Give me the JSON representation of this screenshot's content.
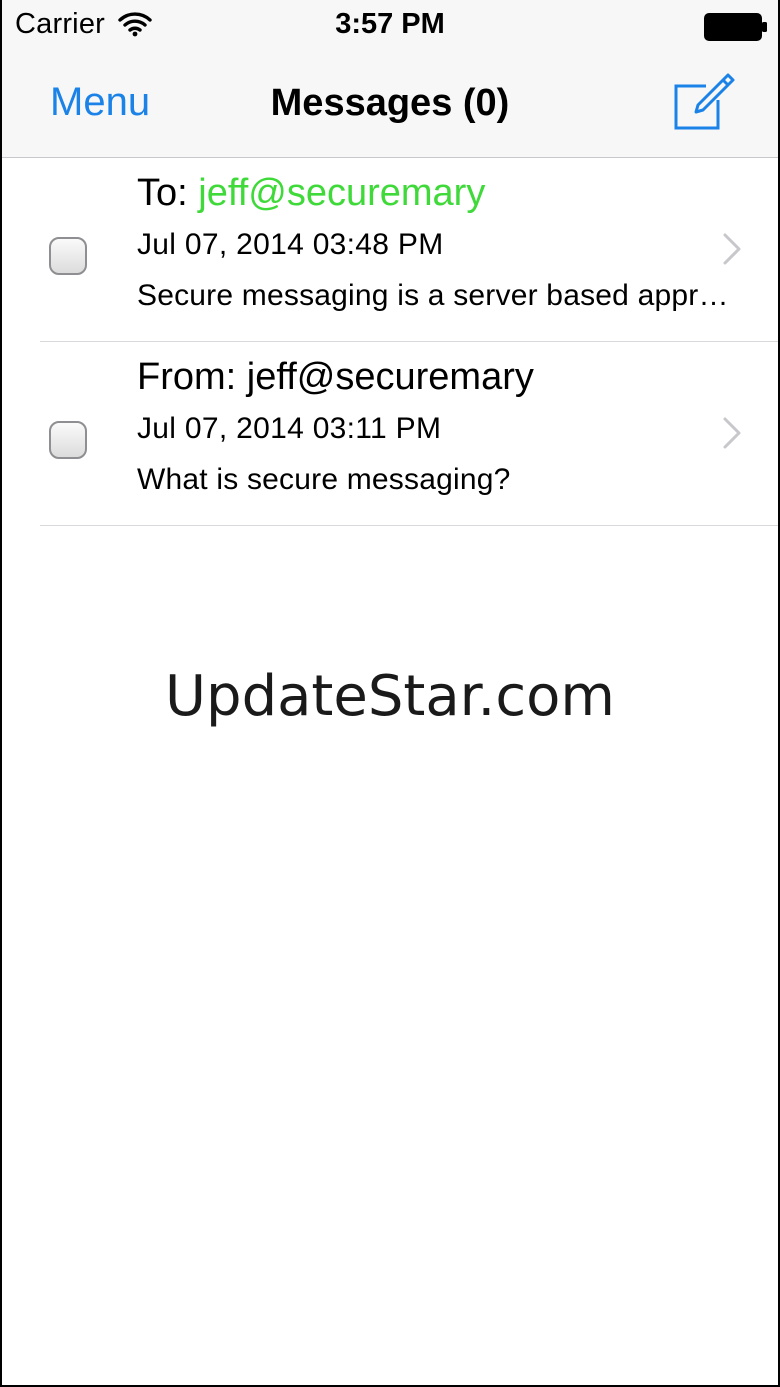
{
  "status_bar": {
    "carrier": "Carrier",
    "time": "3:57 PM",
    "wifi_icon": "wifi-icon",
    "battery_icon": "battery-icon"
  },
  "nav_bar": {
    "left_button": "Menu",
    "title": "Messages (0)",
    "right_icon": "compose-icon"
  },
  "messages": [
    {
      "prefix": "To: ",
      "address": "jeff@securemary",
      "address_color": "#3fd93a",
      "date": "Jul 07, 2014 03:48 PM",
      "preview": "Secure messaging is a server based approach to protect sensitive data"
    },
    {
      "prefix": "From: ",
      "address": "jeff@securemary",
      "address_color": "#000000",
      "date": "Jul 07, 2014 03:11 PM",
      "preview": "What is secure messaging?"
    }
  ],
  "watermark": "UpdateStar.com",
  "colors": {
    "accent": "#1b82e8",
    "bar_background": "#f7f7f7",
    "separator": "#d9d9dd",
    "chevron": "#c7c7cc"
  }
}
